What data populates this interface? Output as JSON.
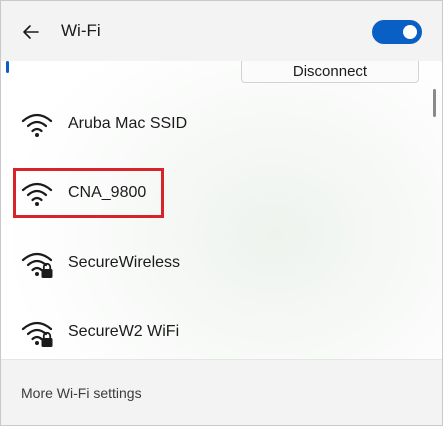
{
  "header": {
    "title": "Wi-Fi",
    "back_icon": "arrow-left-icon",
    "toggle_on": true,
    "accent_color": "#0a5fc4"
  },
  "connected": {
    "disconnect_label": "Disconnect"
  },
  "networks": [
    {
      "name": "Aruba Mac SSID",
      "icon": "wifi-icon",
      "secured": false
    },
    {
      "name": "CNA_9800",
      "icon": "wifi-icon",
      "secured": false,
      "highlighted": true
    },
    {
      "name": "SecureWireless",
      "icon": "wifi-lock-icon",
      "secured": true
    },
    {
      "name": "SecureW2 WiFi",
      "icon": "wifi-lock-icon",
      "secured": true
    }
  ],
  "footer": {
    "settings_label": "More Wi-Fi settings"
  },
  "highlight_color": "#d8232a"
}
